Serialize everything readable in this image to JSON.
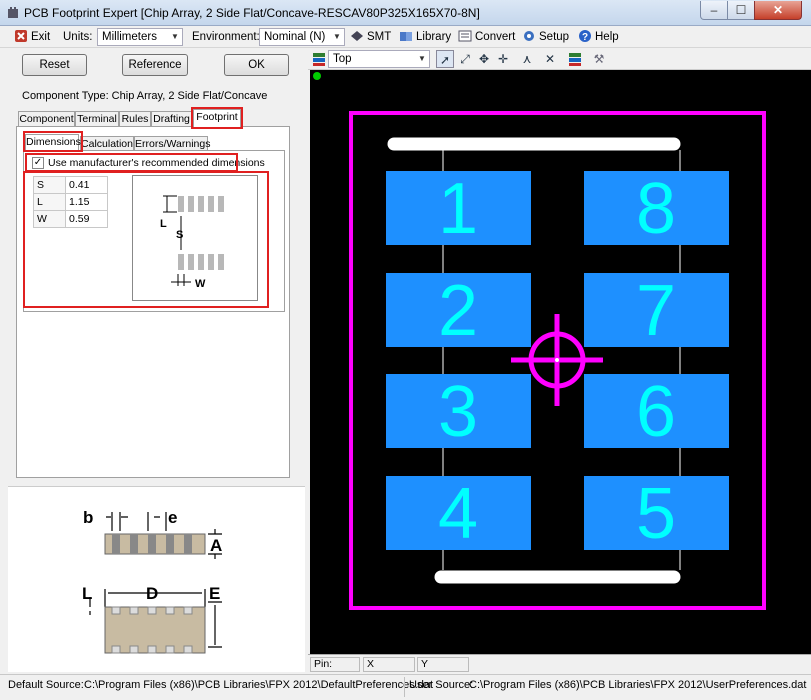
{
  "window": {
    "title": "PCB Footprint Expert [Chip Array, 2 Side Flat/Concave-RESCAV80P325X165X70-8N]",
    "minimize": "‒",
    "maximize": "☐",
    "close": "✕"
  },
  "menu": {
    "exit": "Exit",
    "units_label": "Units:",
    "units_value": "Millimeters",
    "environment_label": "Environment:",
    "environment_value": "Nominal (N)",
    "smt": "SMT",
    "library": "Library",
    "convert": "Convert",
    "setup": "Setup",
    "help": "Help"
  },
  "buttons": {
    "reset": "Reset",
    "reference": "Reference",
    "ok": "OK"
  },
  "component_type": "Component Type: Chip Array, 2 Side Flat/Concave",
  "main_tabs": [
    "Component",
    "Terminal",
    "Rules",
    "Drafting",
    "Footprint"
  ],
  "sub_tabs": [
    "Dimensions",
    "Calculation",
    "Errors/Warnings"
  ],
  "use_manufacturer_label": "Use manufacturer's recommended dimensions",
  "use_manufacturer_checked": "✓",
  "dimensions": [
    {
      "key": "S",
      "value": "0.41"
    },
    {
      "key": "L",
      "value": "1.15"
    },
    {
      "key": "W",
      "value": "0.59"
    }
  ],
  "preview_labels": {
    "l": "L",
    "s": "S",
    "w": "W"
  },
  "diagram_labels": {
    "b": "b",
    "e": "e",
    "A": "A",
    "L": "L",
    "D": "D",
    "E": "E"
  },
  "layer_select": "Top",
  "pads": [
    "1",
    "2",
    "3",
    "4",
    "5",
    "6",
    "7",
    "8"
  ],
  "coords": {
    "pin": "Pin:",
    "x": "X",
    "y": "Y"
  },
  "status": {
    "default_label": "Default Source:",
    "default_path": "C:\\Program Files (x86)\\PCB Libraries\\FPX 2012\\DefaultPreferences.dat",
    "user_label": "User Source:",
    "user_path": "C:\\Program Files (x86)\\PCB Libraries\\FPX 2012\\UserPreferences.dat"
  },
  "colors": {
    "canvas_bg": "#000000",
    "pad_fill": "#1e90ff",
    "pad_number": "#00ffff",
    "courtyard": "#ff00ff",
    "silkscreen": "#ffffff",
    "highlight": "#e02020"
  }
}
